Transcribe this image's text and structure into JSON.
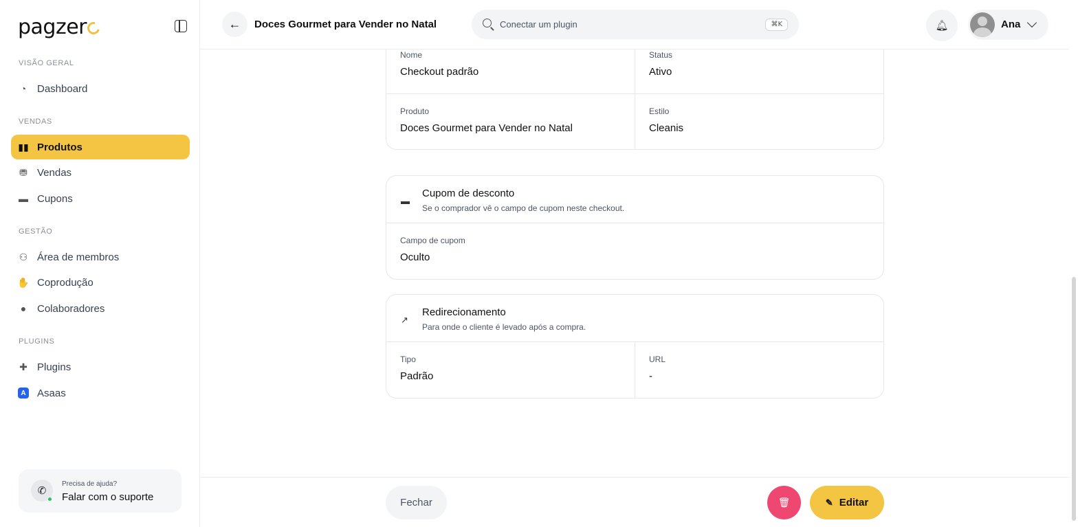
{
  "brand": {
    "logo_text": "pagzer"
  },
  "sidebar": {
    "sections": [
      {
        "label": "VISÃO GERAL"
      },
      {
        "label": "VENDAS"
      },
      {
        "label": "GESTÃO"
      },
      {
        "label": "PLUGINS"
      }
    ],
    "items": [
      {
        "label": "Dashboard",
        "icon": "dashboard-icon"
      },
      {
        "label": "Produtos",
        "icon": "box-icon",
        "active": true
      },
      {
        "label": "Vendas",
        "icon": "money-icon"
      },
      {
        "label": "Cupons",
        "icon": "ticket-icon"
      },
      {
        "label": "Área de membros",
        "icon": "users-icon"
      },
      {
        "label": "Coprodução",
        "icon": "handshake-icon"
      },
      {
        "label": "Colaboradores",
        "icon": "user-icon"
      },
      {
        "label": "Plugins",
        "icon": "puzzle-icon"
      },
      {
        "label": "Asaas",
        "icon": "asaas-icon"
      }
    ],
    "help": {
      "small": "Precisa de ajuda?",
      "main": "Falar com o suporte"
    }
  },
  "topbar": {
    "title": "Doces Gourmet para Vender no Natal",
    "search_placeholder": "Conectar um plugin",
    "shortcut": "⌘K",
    "user_name": "Ana"
  },
  "details": {
    "nome_label": "Nome",
    "nome_value": "Checkout padrão",
    "status_label": "Status",
    "status_value": "Ativo",
    "produto_label": "Produto",
    "produto_value": "Doces Gourmet para Vender no Natal",
    "estilo_label": "Estilo",
    "estilo_value": "Cleanis"
  },
  "coupon": {
    "title": "Cupom de desconto",
    "subtitle": "Se o comprador vê o campo de cupom neste checkout.",
    "field_label": "Campo de cupom",
    "field_value": "Oculto"
  },
  "redirect": {
    "title": "Redirecionamento",
    "subtitle": "Para onde o cliente é levado após a compra.",
    "tipo_label": "Tipo",
    "tipo_value": "Padrão",
    "url_label": "URL",
    "url_value": "-"
  },
  "footer": {
    "close_label": "Fechar",
    "edit_label": "Editar"
  },
  "colors": {
    "accent": "#f4c542",
    "danger": "#ee4872",
    "online": "#22c55e"
  }
}
